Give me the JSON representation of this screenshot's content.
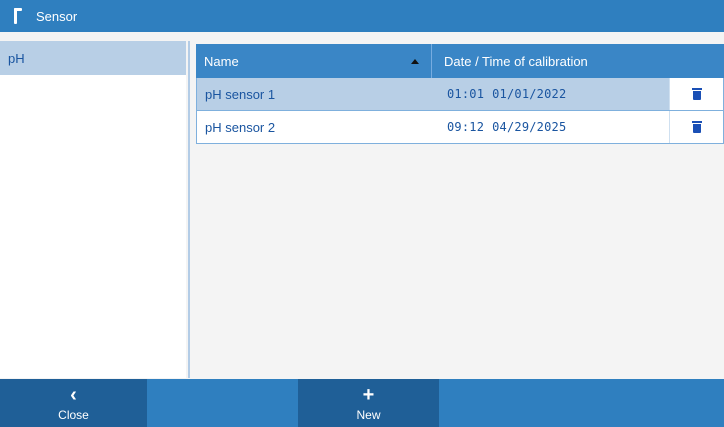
{
  "window": {
    "title": "Sensor"
  },
  "categories": [
    {
      "label": "pH",
      "selected": true
    }
  ],
  "table": {
    "columns": {
      "name": "Name",
      "date_time": "Date / Time of calibration"
    },
    "sort": {
      "column": "name",
      "direction": "ascending"
    },
    "rows": [
      {
        "name": "pH sensor 1",
        "time": "01:01",
        "date": "01/01/2022",
        "selected": true
      },
      {
        "name": "pH sensor 2",
        "time": "09:12",
        "date": "04/29/2025",
        "selected": false
      }
    ]
  },
  "toolbar": {
    "close_label": "Close",
    "close_icon": "chevron-left-icon",
    "new_label": "New",
    "new_icon": "plus-icon"
  },
  "colors": {
    "accent": "#2f7fbf",
    "header": "#3a86c6",
    "selection": "#b8cfe6",
    "text": "#1a55a0",
    "button_dark": "#1f5f97"
  }
}
